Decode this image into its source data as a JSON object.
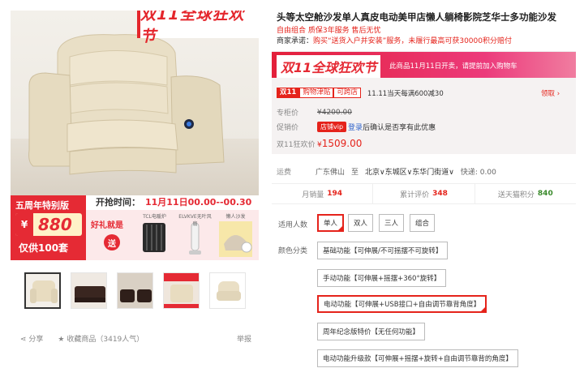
{
  "gallery": {
    "promo_top": "双11全球狂欢节",
    "banner": {
      "anniversary": "五周年特别版",
      "currency": "¥",
      "price": "880",
      "limit": "仅供100套",
      "countdown_label": "开抢时间：",
      "countdown": "11月11日00.00--00.30",
      "gift_title": "好礼就是",
      "gift_badge": "送",
      "gift_items": [
        "TCL电暖炉",
        "ELVKVE无叶风扇",
        "懒人沙发"
      ]
    },
    "thumbnails": [
      {
        "name": "thumb-1",
        "style": "cream",
        "active": true
      },
      {
        "name": "thumb-2",
        "style": "dark",
        "active": false
      },
      {
        "name": "thumb-3",
        "style": "dark",
        "active": false
      },
      {
        "name": "thumb-4",
        "style": "red",
        "active": false
      },
      {
        "name": "thumb-5",
        "style": "cream",
        "active": false
      }
    ],
    "share_label": "分享",
    "favorite_label": "收藏商品",
    "favorite_count": "（3419人气）",
    "report_label": "举报"
  },
  "product": {
    "title": "头等太空舱沙发单人真皮电动美甲店懒人躺椅影院芝华士多功能沙发",
    "subtitle": "自由组合 质保3年服务 售后无忧",
    "merchant_promise_label": "商家承诺：",
    "merchant_promise": "购买“送货入户并安装”服务，未履行最高可获30000积分赔付"
  },
  "price_panel": {
    "banner_logo": "双11全球狂欢节",
    "banner_text": "此商品11月11日开卖，请提前加入购物车",
    "tag_double11": "双11",
    "tag_coupon": "购物津贴",
    "tag_crossstore": "可跨店",
    "tag_rule": "11.11当天每满600减30",
    "tag_get": "领取 ›",
    "list_price_label": "专柜价",
    "list_price": "¥4200.00",
    "promo_label": "促销价",
    "vip_badge": "店铺vip",
    "login_link": "登录",
    "login_after": "后确认是否享有此优惠",
    "final_label": "双11狂欢价",
    "final_currency": "¥",
    "final_price": "1509.00"
  },
  "shipping": {
    "label": "运费",
    "from": "广东佛山",
    "to_word": "至",
    "region": [
      "北京",
      "东城区",
      "东华门街道"
    ],
    "express": "快递: 0.00"
  },
  "stats": {
    "sales_label": "月销量",
    "sales": "194",
    "reviews_label": "累计评价",
    "reviews": "348",
    "points_label": "送天猫积分",
    "points": "840"
  },
  "sku": {
    "people_label": "适用人数",
    "people_options": [
      "单人",
      "双人",
      "三人",
      "组合"
    ],
    "people_selected": 0,
    "color_label": "颜色分类",
    "color_options": [
      "基础功能【可伸展/不可摇摆不可旋转】",
      "手动功能【可伸展+摇摆+360°旋转】",
      "电动功能【可伸展+USB接口+自由调节靠背角度】",
      "周年纪念版特价【无任何功能】",
      "电动功能升级款【可伸展+摇摆+旋转+自由调节靠背的角度】"
    ],
    "color_selected": 2
  },
  "colors": {
    "accent": "#e5231b",
    "banner_red": "#e52a34",
    "link": "#3366cc"
  }
}
